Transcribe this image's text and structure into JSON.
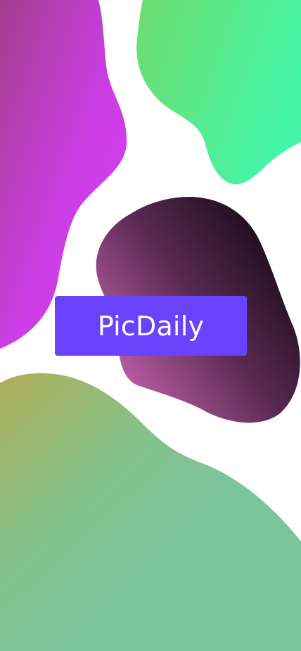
{
  "app": {
    "brand_name": "PicDaily"
  },
  "colors": {
    "background": "#ffffff",
    "brand_badge": "#6a42fb",
    "brand_text": "#ffffff",
    "blob_magenta_start": "#a23e8d",
    "blob_magenta_end": "#d33ef1",
    "blob_green_start": "#6ddc6e",
    "blob_green_end": "#45f6a8",
    "blob_dark_start": "#1b0c19",
    "blob_dark_end": "#b65ca1",
    "blob_bottom_start": "#b0ad58",
    "blob_bottom_end": "#7bc59d"
  }
}
